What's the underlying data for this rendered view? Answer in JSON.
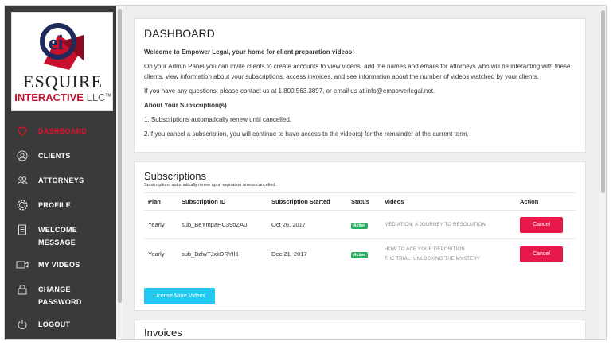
{
  "sidebar": {
    "logo": {
      "line1": "ESQUIRE",
      "line2": "INTERACTIVE",
      "line2b": "LLC",
      "trademark": "TM",
      "monogram": "ei"
    },
    "items": [
      {
        "label": "DASHBOARD",
        "icon": "heart-shield-icon",
        "active": true
      },
      {
        "label": "CLIENTS",
        "icon": "user-icon"
      },
      {
        "label": "ATTORNEYS",
        "icon": "users-icon"
      },
      {
        "label": "PROFILE",
        "icon": "gear-icon"
      },
      {
        "label": "WELCOME",
        "label2": "MESSAGE",
        "icon": "document-icon"
      },
      {
        "label": "MY VIDEOS",
        "icon": "video-camera-icon"
      },
      {
        "label": "CHANGE",
        "label2": "PASSWORD",
        "icon": "lock-icon"
      },
      {
        "label": "LOGOUT",
        "icon": "power-icon"
      }
    ]
  },
  "dashboard": {
    "title": "DASHBOARD",
    "welcome": "Welcome to Empower Legal, your home for client preparation videos!",
    "intro": "On your Admin Panel you can invite clients to create accounts to view videos, add the names and emails for attorneys who will be interacting with these clients, view information about your subscriptions, access invoices, and see information about the number of videos watched by your clients.",
    "contact": "If you have any questions, please contact us at 1.800.563.3897, or email us at info@empowerlegal.net.",
    "about_heading": "About Your Subscription(s)",
    "about_1": "1. Subscriptions automatically renew until cancelled.",
    "about_2": "2.If you cancel a subscription, you will continue to have access to the video(s) for the remainder of the current term."
  },
  "subscriptions": {
    "title": "Subscriptions",
    "note": "Subscriptions automatically renew upon expiration unless cancelled.",
    "columns": [
      "Plan",
      "Subscription ID",
      "Subscription Started",
      "Status",
      "Videos",
      "Action"
    ],
    "rows": [
      {
        "plan": "Yearly",
        "id": "sub_BeYmpaHC39oZAu",
        "started": "Oct 26, 2017",
        "status": "Active",
        "videos": [
          "MEDIATION: A JOURNEY TO RESOLUTION"
        ],
        "action": "Cancel"
      },
      {
        "plan": "Yearly",
        "id": "sub_BzlwTJxkDRYIl6",
        "started": "Dec 21, 2017",
        "status": "Active",
        "videos": [
          "HOW TO ACE YOUR DEPOSITION",
          "THE TRIAL: UNLOCKING THE MYSTERY"
        ],
        "action": "Cancel"
      }
    ],
    "license_button": "License More Videos"
  },
  "invoices": {
    "title": "Invoices"
  },
  "colors": {
    "accent": "#e0112b",
    "sidebar_bg": "#3a3a3a",
    "cancel": "#e8184a",
    "license": "#22c8ef",
    "active_badge": "#27ae60"
  }
}
